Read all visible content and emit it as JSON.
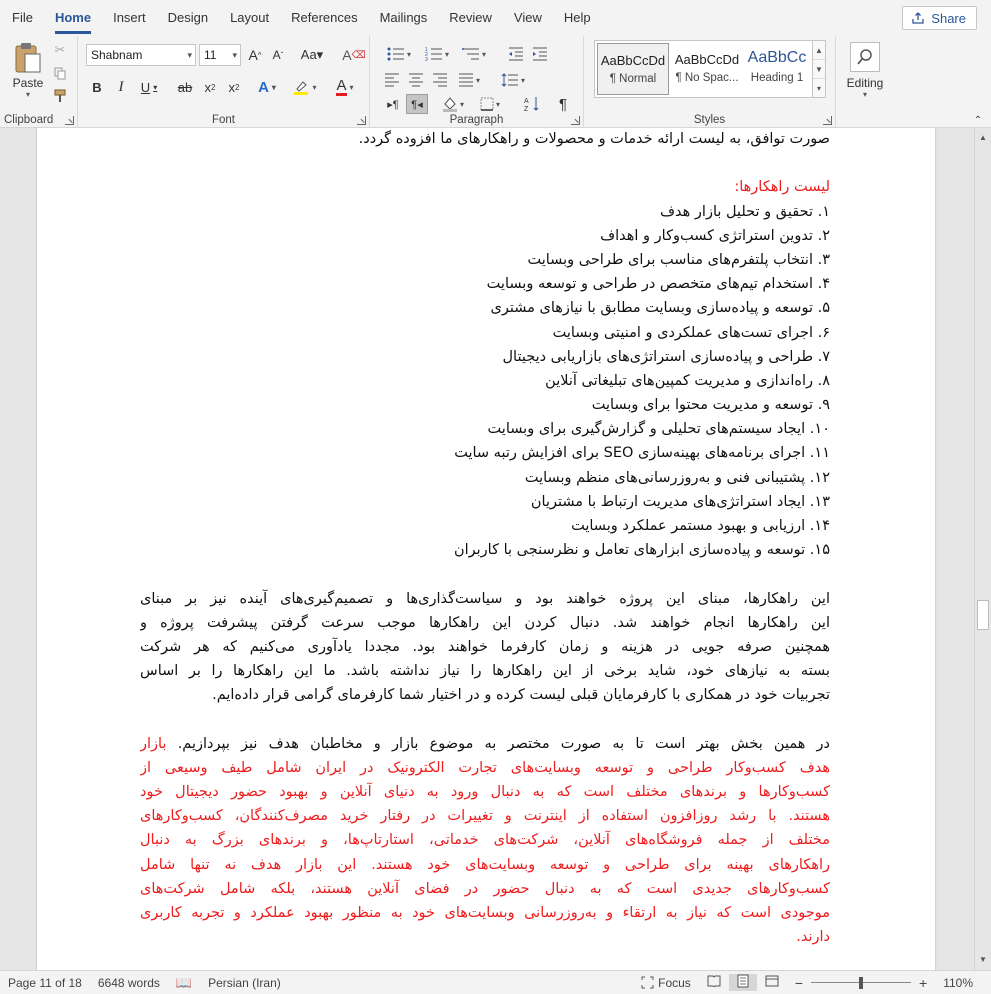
{
  "menu": {
    "items": [
      "File",
      "Home",
      "Insert",
      "Design",
      "Layout",
      "References",
      "Mailings",
      "Review",
      "View",
      "Help"
    ],
    "active": "Home",
    "share_label": "Share"
  },
  "ribbon": {
    "clipboard": {
      "paste_label": "Paste",
      "group_label": "Clipboard"
    },
    "font": {
      "font_name": "Shabnam",
      "font_size": "11",
      "group_label": "Font"
    },
    "paragraph": {
      "group_label": "Paragraph"
    },
    "styles": {
      "group_label": "Styles",
      "items": [
        {
          "preview": "AaBbCcDd",
          "name": "¶ Normal"
        },
        {
          "preview": "AaBbCcDd",
          "name": "¶ No Spac..."
        },
        {
          "preview": "AaBbCc",
          "name": "Heading 1"
        }
      ]
    },
    "editing": {
      "label": "Editing"
    }
  },
  "document": {
    "intro_lines": [
      "صورت توافق، به لیست ارائه خدمات و محصولات و راهکارهای ما افزوده گردد."
    ],
    "heading": "لیست راهکارها:",
    "list": [
      "۱. تحقیق و تحلیل بازار هدف",
      "۲. تدوین استراتژی کسب‌وکار و اهداف",
      "۳. انتخاب پلتفرم‌های مناسب برای طراحی وبسایت",
      "۴. استخدام تیم‌های متخصص در طراحی و توسعه وبسایت",
      "۵. توسعه و پیاده‌سازی وبسایت مطابق با نیازهای مشتری",
      "۶. اجرای تست‌های عملکردی و امنیتی وبسایت",
      "۷. طراحی و پیاده‌سازی استراتژی‌های بازاریابی دیجیتال",
      "۸. راه‌اندازی و مدیریت کمپین‌های تبلیغاتی آنلاین",
      "۹. توسعه و مدیریت محتوا برای وبسایت",
      "۱۰. ایجاد سیستم‌های تحلیلی و گزارش‌گیری برای وبسایت",
      "۱۱. اجرای برنامه‌های بهینه‌سازی SEO برای افزایش رتبه سایت",
      "۱۲. پشتیبانی فنی و به‌روزرسانی‌های منظم وبسایت",
      "۱۳. ایجاد استراتژی‌های مدیریت ارتباط با مشتریان",
      "۱۴. ارزیابی و بهبود مستمر عملکرد وبسایت",
      "۱۵. توسعه و پیاده‌سازی ابزارهای تعامل و نظرسنجی با کاربران"
    ],
    "paragraph1": [
      "این راهکارها، مبنای این پروژه خواهند بود و سیاست‌گذاری‌ها و تصمیم‌گیری‌های آینده نیز بر مبنای",
      "این راهکارها انجام خواهند شد. دنبال کردن این راهکارها موجب سرعت گرفتن پیشرفت پروژه و",
      "همچنین صرفه جویی در هزینه و زمان کارفرما خواهند بود. مجددا یادآوری می‌کنیم که هر شرکت",
      "بسته به نیازهای خود، شاید برخی از این راهکارها را نیاز نداشته باشد. ما این راهکارها را بر اساس",
      "تجربیات خود در همکاری با کارفرمایان قبلی لیست کرده و در اختیار شما کارفرمای گرامی قرار داده‌ایم."
    ],
    "paragraph2_black": "در همین بخش بهتر است تا به صورت مختصر به موضوع بازار و مخاطبان هدف نیز بپردازیم.",
    "paragraph2_red_first": "بازار",
    "paragraph2_red_lines": [
      "هدف کسب‌وکار طراحی و توسعه وبسایت‌های تجارت الکترونیک در ایران شامل طیف وسیعی از",
      "کسب‌وکارها و برندهای مختلف است که به دنبال ورود به دنیای آنلاین و بهبود حضور دیجیتال خود",
      "هستند. با رشد روزافزون استفاده از اینترنت و تغییرات در رفتار خرید مصرف‌کنندگان، کسب‌وکارهای",
      "مختلف از جمله فروشگاه‌های آنلاین، شرکت‌های خدماتی، استارتاپ‌ها، و برندهای بزرگ به دنبال",
      "راهکارهای بهینه برای طراحی و توسعه وبسایت‌های خود هستند. این بازار هدف نه تنها شامل",
      "کسب‌وکارهای جدیدی است که به دنبال حضور در فضای آنلاین هستند، بلکه شامل شرکت‌های",
      "موجودی است که نیاز به ارتقاء و به‌روزرسانی وبسایت‌های خود به منظور بهبود عملکرد و تجربه کاربری",
      "دارند."
    ]
  },
  "status": {
    "page": "Page 11 of 18",
    "words": "6648 words",
    "language": "Persian (Iran)",
    "focus": "Focus",
    "zoom": "110%"
  }
}
